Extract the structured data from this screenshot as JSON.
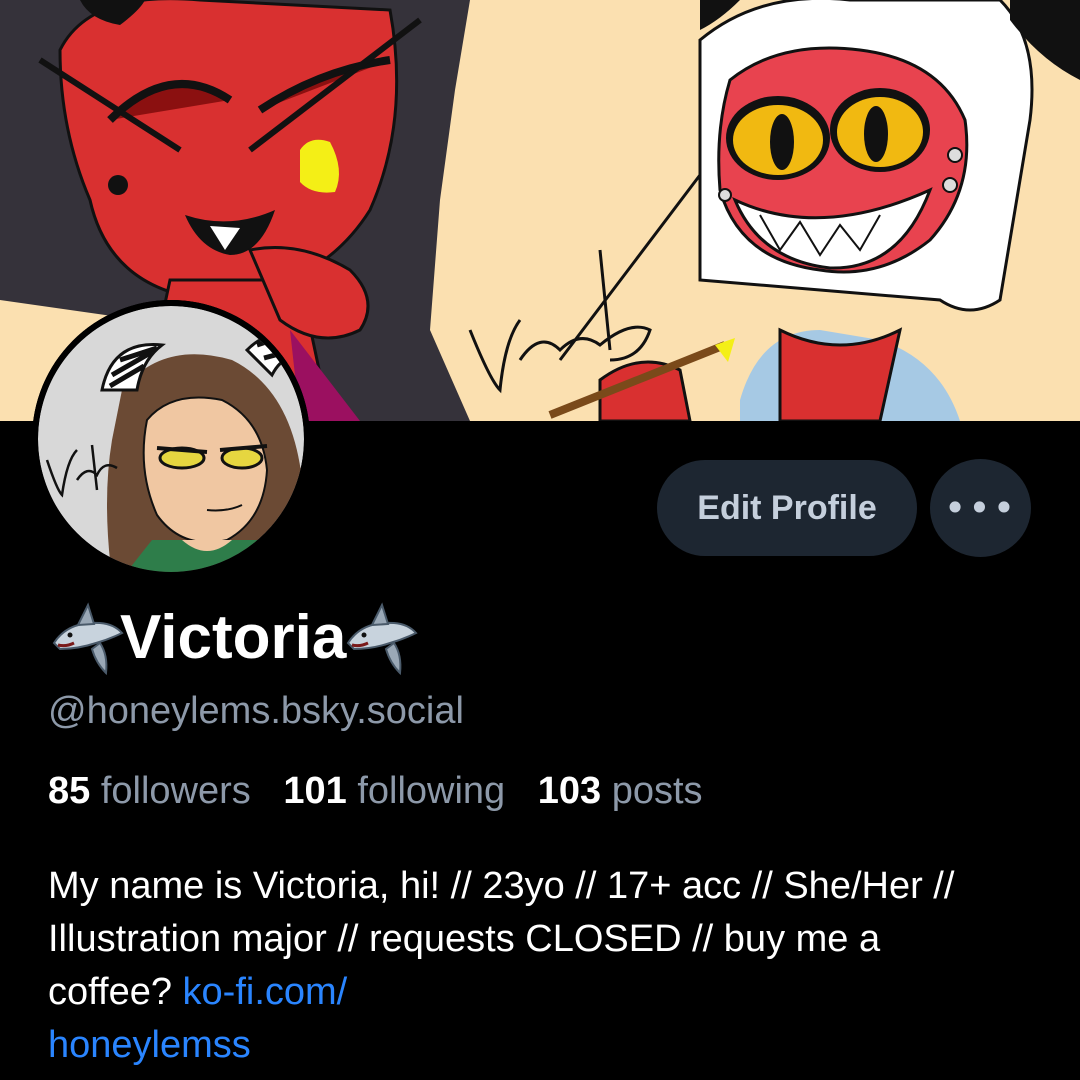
{
  "profile": {
    "display_name": "Victoria",
    "name_emoji_left": "shark-icon",
    "name_emoji_right": "shark-icon",
    "handle": "@honeylems.bsky.social",
    "banner_signature": "Victoria",
    "avatar_signature": "Vict"
  },
  "actions": {
    "edit_label": "Edit Profile",
    "more_label": "•••"
  },
  "stats": {
    "followers_count": "85",
    "followers_label": "followers",
    "following_count": "101",
    "following_label": "following",
    "posts_count": "103",
    "posts_label": "posts"
  },
  "bio": {
    "text": "My name is Victoria, hi! // 23yo // 17+ acc // She/Her // Illustration major // requests CLOSED // buy me a coffee?",
    "link_line1": "ko-fi.com/",
    "link_line2": "honeylemss"
  },
  "colors": {
    "background": "#000000",
    "button_bg": "#1d2631",
    "button_text": "#c5cfdc",
    "muted_text": "#8d99a9",
    "link": "#2a85ff"
  }
}
